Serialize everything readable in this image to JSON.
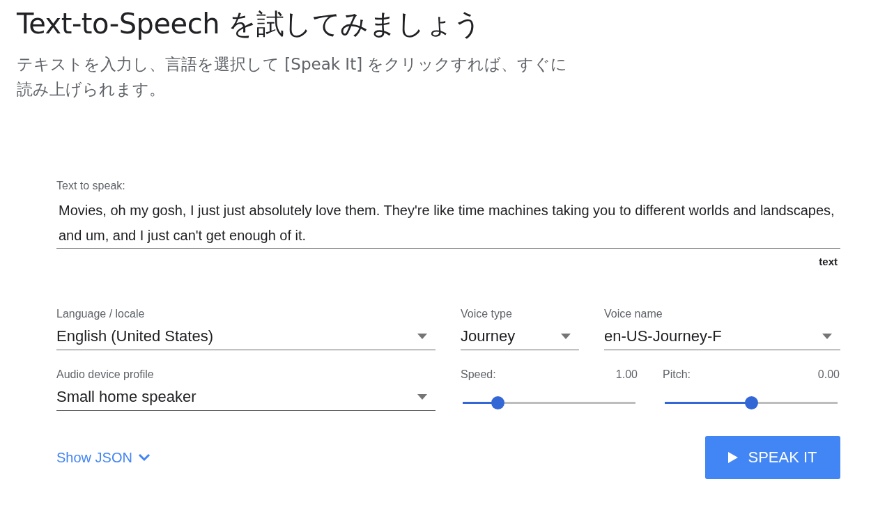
{
  "title": "Text-to-Speech を試してみましょう",
  "subtitle": "テキストを入力し、言語を選択して [Speak It] をクリックすれば、すぐに読み上げられます。",
  "text_field": {
    "label": "Text to speak:",
    "value": "Movies, oh my gosh, I just just absolutely love them. They're like time machines taking you to different worlds and landscapes, and um, and I just can't get enough of it.",
    "mode": "text"
  },
  "selects": [
    {
      "label": "Language / locale",
      "value": "English (United States)"
    },
    {
      "label": "Voice type",
      "value": "Journey"
    },
    {
      "label": "Voice name",
      "value": "en-US-Journey-F"
    },
    {
      "label": "Audio device profile",
      "value": "Small home speaker"
    }
  ],
  "sliders": [
    {
      "label": "Speed:",
      "reading": "1.00",
      "level": 0.2
    },
    {
      "label": "Pitch:",
      "reading": "0.00",
      "level": 0.5
    }
  ],
  "show_json": {
    "label": "Show JSON"
  },
  "speak_button": {
    "label": "SPEAK IT"
  }
}
